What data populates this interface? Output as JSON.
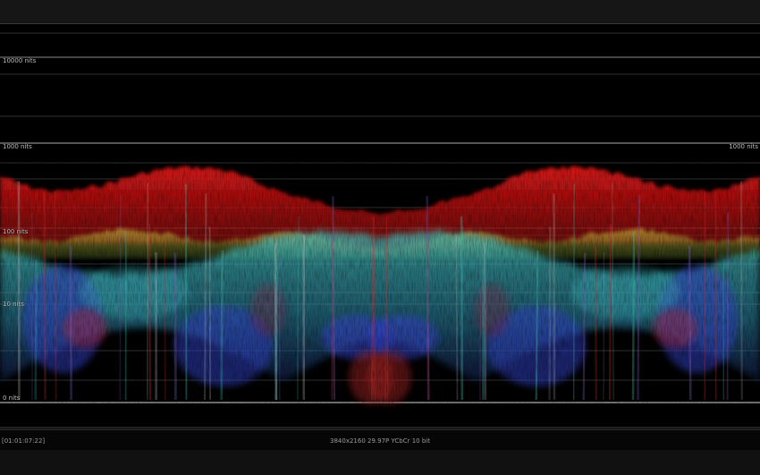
{
  "scope": {
    "labels": {
      "n10000": "10000 nits",
      "n1000_left": "1000 nits",
      "n1000_right": "1000 nits",
      "n100": "100 nits",
      "n10": "10 nits",
      "n0": "0 nits"
    },
    "colors": {
      "background": "#000000",
      "red_trace": "#d01010",
      "green_trace": "#3fbf5f",
      "cyan_trace": "#3fb8c0",
      "blue_trace": "#3040c0",
      "graticule": "#5a5a5a",
      "graticule_bright": "#9a9a9a"
    }
  },
  "status": {
    "timecode": "[01:01:07:22]",
    "format": "3840x2160 29.97P YCbCr 10 bit"
  }
}
